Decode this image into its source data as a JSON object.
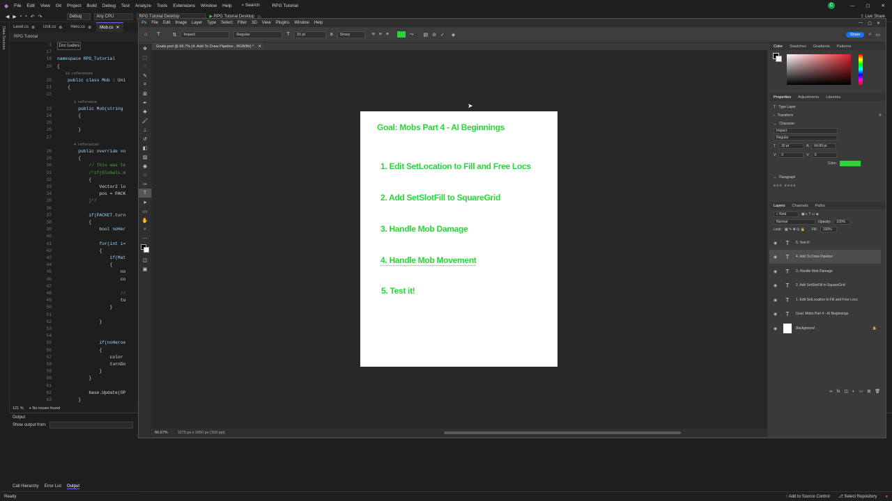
{
  "vs": {
    "menu": [
      "File",
      "Edit",
      "View",
      "Git",
      "Project",
      "Build",
      "Debug",
      "Test",
      "Analyze",
      "Tools",
      "Extensions",
      "Window",
      "Help"
    ],
    "search_label": "Search",
    "title": "RPG Tutorial",
    "config": "Debug",
    "platform": "Any CPU",
    "startup": "RPG Tutorial Desktop",
    "run_label": "RPG Tutorial Desktop",
    "share_label": "Live Share",
    "tabs": [
      "Level.cs",
      "Unit.cs",
      "Hero.cs",
      "Mob.cs"
    ],
    "nav": "RPG Tutorial",
    "code_lines": [
      {
        "n": "1",
        "t": "Includes"
      },
      {
        "n": "17",
        "t": ""
      },
      {
        "n": "18",
        "t": "namespace RPG_Tutorial"
      },
      {
        "n": "19",
        "t": "{"
      },
      {
        "n": "",
        "t": "    10 references"
      },
      {
        "n": "20",
        "t": "    public class Mob : Uni"
      },
      {
        "n": "21",
        "t": "    {"
      },
      {
        "n": "22",
        "t": ""
      },
      {
        "n": "",
        "t": "        1 reference"
      },
      {
        "n": "23",
        "t": "        public Mob(string"
      },
      {
        "n": "24",
        "t": "        {"
      },
      {
        "n": "25",
        "t": ""
      },
      {
        "n": "26",
        "t": "        }"
      },
      {
        "n": "27",
        "t": ""
      },
      {
        "n": "",
        "t": "        4 references"
      },
      {
        "n": "28",
        "t": "        public override vo"
      },
      {
        "n": "29",
        "t": "        {"
      },
      {
        "n": "30",
        "t": "            // This was te"
      },
      {
        "n": "31",
        "t": "            /*if(Globals.m"
      },
      {
        "n": "32",
        "t": "            {"
      },
      {
        "n": "33",
        "t": "                Vector2 lo"
      },
      {
        "n": "34",
        "t": "                pos = PACK"
      },
      {
        "n": "35",
        "t": "            }*/"
      },
      {
        "n": "36",
        "t": ""
      },
      {
        "n": "37",
        "t": "            if(PACKET.turn"
      },
      {
        "n": "38",
        "t": "            {"
      },
      {
        "n": "39",
        "t": "                bool noHer"
      },
      {
        "n": "40",
        "t": ""
      },
      {
        "n": "41",
        "t": "                for(int i="
      },
      {
        "n": "42",
        "t": "                {"
      },
      {
        "n": "43",
        "t": "                    if(Mat"
      },
      {
        "n": "44",
        "t": "                    {"
      },
      {
        "n": "45",
        "t": "                        no"
      },
      {
        "n": "46",
        "t": "                        co"
      },
      {
        "n": "47",
        "t": ""
      },
      {
        "n": "48",
        "t": "                        //"
      },
      {
        "n": "49",
        "t": "                        tu"
      },
      {
        "n": "50",
        "t": "                    }"
      },
      {
        "n": "51",
        "t": ""
      },
      {
        "n": "52",
        "t": "                }"
      },
      {
        "n": "53",
        "t": ""
      },
      {
        "n": "54",
        "t": ""
      },
      {
        "n": "55",
        "t": "                if(noHeroe"
      },
      {
        "n": "56",
        "t": "                {"
      },
      {
        "n": "57",
        "t": "                    color"
      },
      {
        "n": "58",
        "t": "                    turnDo"
      },
      {
        "n": "59",
        "t": "                }"
      },
      {
        "n": "60",
        "t": "            }"
      },
      {
        "n": "61",
        "t": ""
      },
      {
        "n": "62",
        "t": "            base.Update(OP"
      },
      {
        "n": "63",
        "t": "        }"
      }
    ],
    "zoom": "121 %",
    "issues": "No issues found",
    "output_title": "Output",
    "output_from": "Show output from:",
    "bottom_tabs": [
      "Call Hierarchy",
      "Error List",
      "Output"
    ],
    "status_left": "Ready",
    "status_source": "Add to Source Control",
    "status_repo": "Select Repository"
  },
  "ps": {
    "menu": [
      "File",
      "Edit",
      "Image",
      "Layer",
      "Type",
      "Select",
      "Filter",
      "3D",
      "View",
      "Plugins",
      "Window",
      "Help"
    ],
    "font_family": "Impact",
    "font_style": "Regular",
    "font_size": "30 pt",
    "antialias": "Sharp",
    "text_color": "#2ad43a",
    "share_label": "Share",
    "doc_tab": "Goals.psd @ 66.7% (4. Add To Draw Pipeline , RGB/8#) *",
    "doc_title": "Goal: Mobs Part 4 - AI Beginnings",
    "goals": [
      "1. Edit SetLocation to Fill and Free Locs",
      "2. Add SetSlotFill to SquareGrid",
      "3. Handle Mob Damage",
      "4. Handle Mob Movement",
      "5. Test it!"
    ],
    "zoom": "66.67%",
    "doc_size": "1275 px x 1650 px (150 ppi)",
    "color_tabs": [
      "Color",
      "Swatches",
      "Gradients",
      "Patterns"
    ],
    "prop_tabs": [
      "Properties",
      "Adjustments",
      "Libraries"
    ],
    "prop_type": "Type Layer",
    "transform": "Transform",
    "character": "Character",
    "char_font": "Impact",
    "char_style": "Regular",
    "char_size": "30 pt",
    "char_leading": "64.89 pt",
    "char_tracking": "0",
    "char_kerning": "0",
    "char_color_label": "Color:",
    "paragraph": "Paragraph",
    "layer_tabs": [
      "Layers",
      "Channels",
      "Paths"
    ],
    "layer_kind": "Kind",
    "blend_mode": "Normal",
    "opacity_label": "Opacity:",
    "opacity": "100%",
    "lock_label": "Lock:",
    "fill_label": "Fill:",
    "fill": "100%",
    "layers": [
      "5. Test it!",
      "4. Add To Draw Pipeline",
      "3. Handle Mob Damage",
      "2. Add SetSlotFill to SquareGrid",
      "1. Edit SetLocation to Fill and Free Locs",
      "Goal: Mobs Part 4 - AI Beginnings",
      "Background"
    ]
  }
}
